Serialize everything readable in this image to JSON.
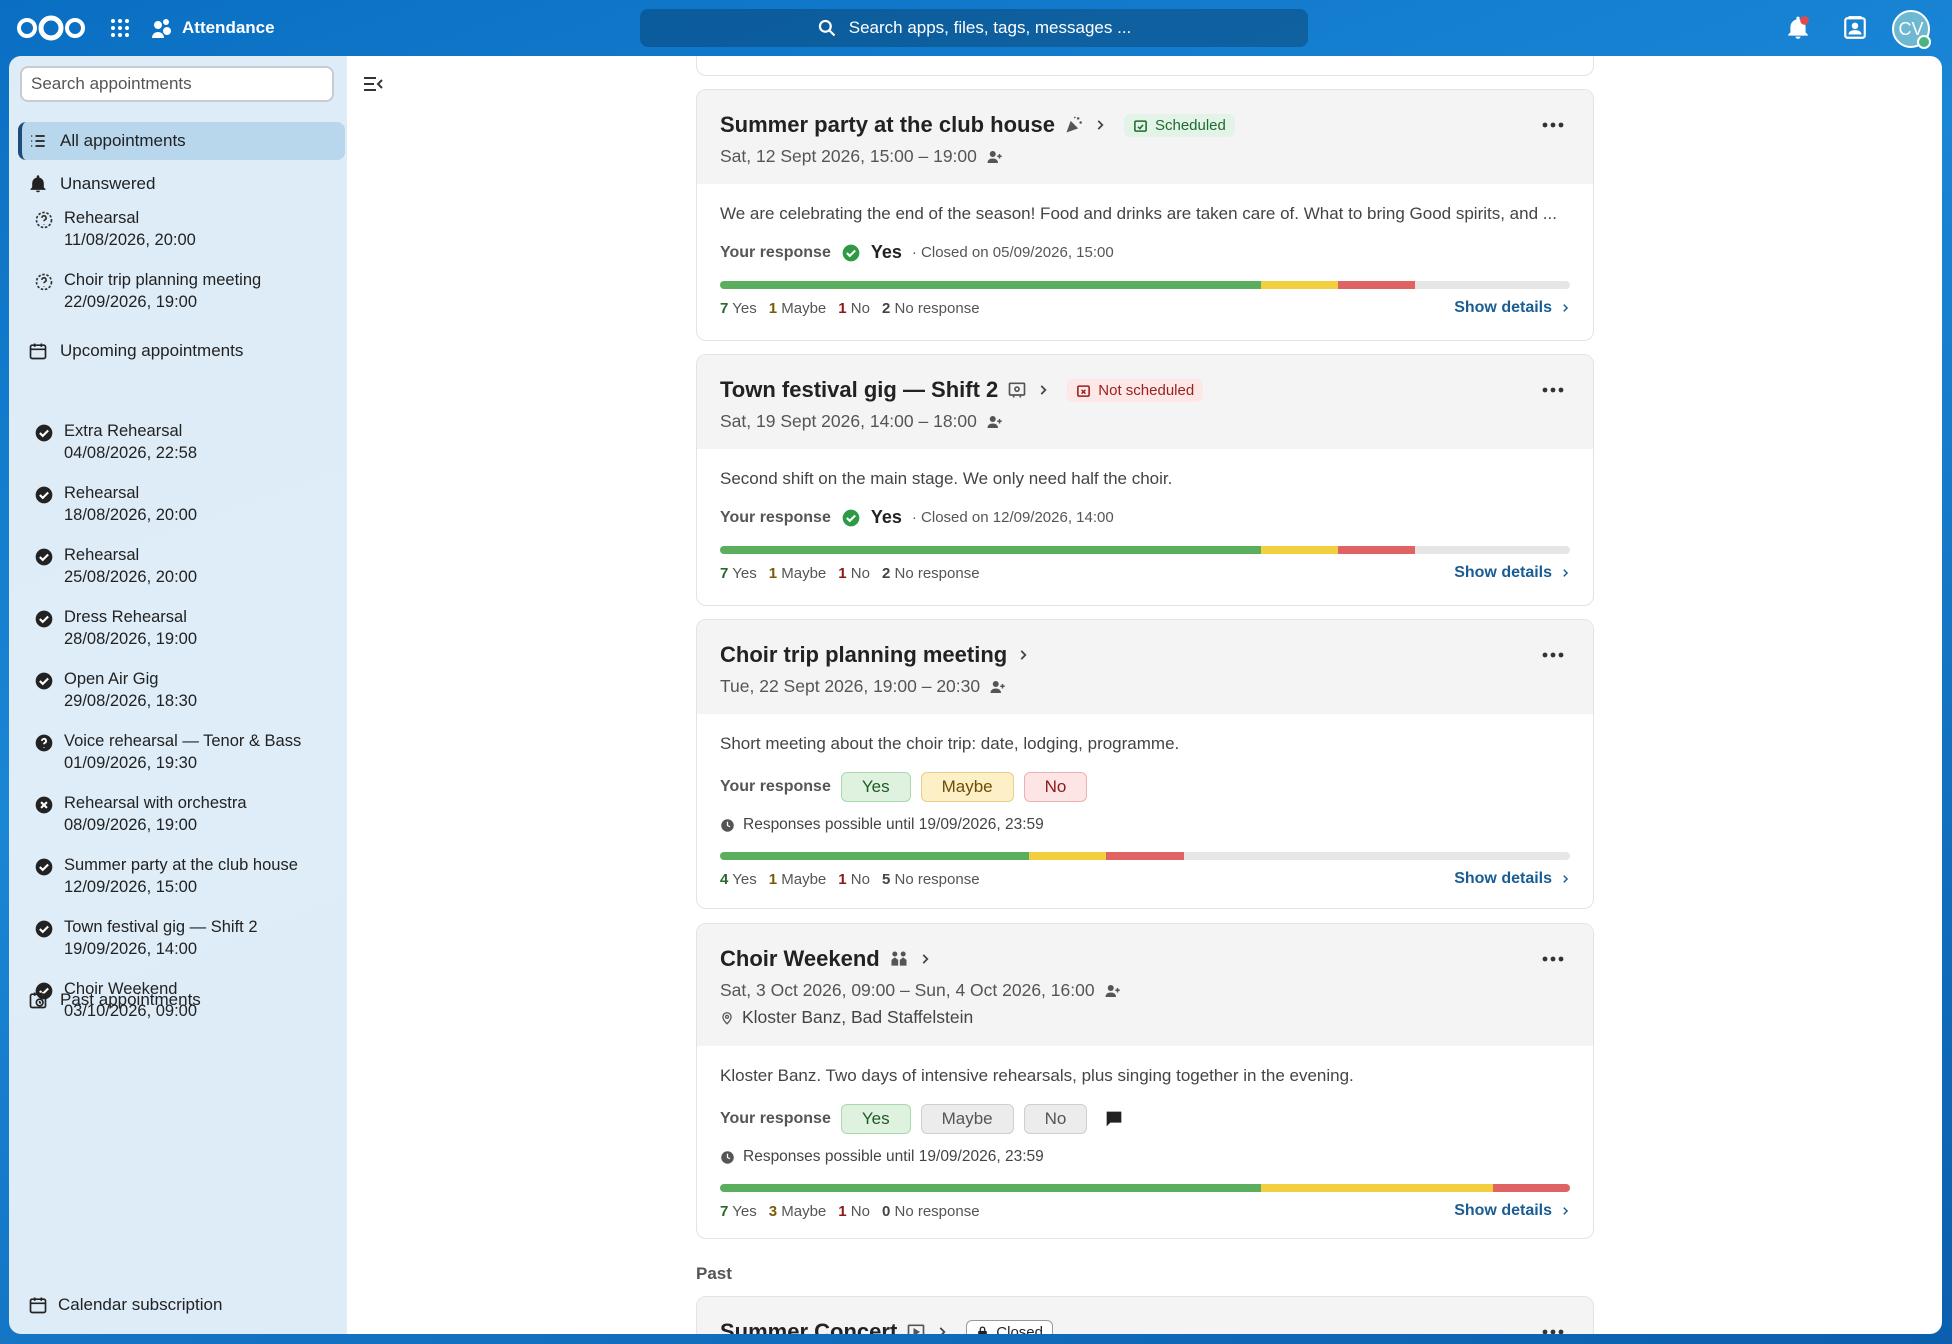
{
  "header": {
    "app_name": "Attendance",
    "search_placeholder": "Search apps, files, tags, messages ...",
    "avatar_initials": "CV"
  },
  "sidebar": {
    "search_placeholder": "Search appointments",
    "all_label": "All appointments",
    "unanswered_label": "Unanswered",
    "unanswered": [
      {
        "title": "Rehearsal",
        "date": "11/08/2026, 20:00"
      },
      {
        "title": "Choir trip planning meeting",
        "date": "22/09/2026, 19:00"
      }
    ],
    "upcoming_label": "Upcoming appointments",
    "upcoming": [
      {
        "title": "Extra Rehearsal",
        "date": "04/08/2026, 22:58",
        "status": "yes"
      },
      {
        "title": "Rehearsal",
        "date": "18/08/2026, 20:00",
        "status": "yes"
      },
      {
        "title": "Rehearsal",
        "date": "25/08/2026, 20:00",
        "status": "yes"
      },
      {
        "title": "Dress Rehearsal",
        "date": "28/08/2026, 19:00",
        "status": "yes"
      },
      {
        "title": "Open Air Gig",
        "date": "29/08/2026, 18:30",
        "status": "yes"
      },
      {
        "title": "Voice rehearsal — Tenor & Bass",
        "date": "01/09/2026, 19:30",
        "status": "maybe"
      },
      {
        "title": "Rehearsal with orchestra",
        "date": "08/09/2026, 19:00",
        "status": "no"
      },
      {
        "title": "Summer party at the club house",
        "date": "12/09/2026, 15:00",
        "status": "yes"
      },
      {
        "title": "Town festival gig — Shift 2",
        "date": "19/09/2026, 14:00",
        "status": "yes"
      },
      {
        "title": "Choir Weekend",
        "date": "03/10/2026, 09:00",
        "status": "yes"
      }
    ],
    "past_label": "Past appointments",
    "footer_label": "Calendar subscription"
  },
  "common": {
    "your_response": "Your response",
    "show_details": "Show details",
    "yes": "Yes",
    "maybe": "Maybe",
    "no": "No",
    "no_response": "No response"
  },
  "cards": [
    {
      "title": "Summer party at the club house",
      "icon": "party-popper-icon",
      "badge": {
        "label": "Scheduled",
        "kind": "ok"
      },
      "time": "Sat, 12 Sept 2026, 15:00 – 19:00",
      "description": "We are celebrating the end of the season! Food and drinks are taken care of. What to bring Good spirits, and ...",
      "response": "Yes",
      "closed_on": "· Closed on 05/09/2026, 15:00",
      "counts": {
        "yes": 7,
        "maybe": 1,
        "no": 1,
        "none": 2
      }
    },
    {
      "title": "Town festival gig — Shift 2",
      "icon": "stage-icon",
      "badge": {
        "label": "Not scheduled",
        "kind": "no"
      },
      "time": "Sat, 19 Sept 2026, 14:00 – 18:00",
      "description": "Second shift on the main stage. We only need half the choir.",
      "response": "Yes",
      "closed_on": "· Closed on 12/09/2026, 14:00",
      "counts": {
        "yes": 7,
        "maybe": 1,
        "no": 1,
        "none": 2
      }
    },
    {
      "title": "Choir trip planning meeting",
      "time": "Tue, 22 Sept 2026, 19:00 – 20:30",
      "description": "Short meeting about the choir trip: date, lodging, programme.",
      "deadline": "Responses possible until 19/09/2026, 23:59",
      "counts": {
        "yes": 4,
        "maybe": 1,
        "no": 1,
        "none": 5
      }
    },
    {
      "title": "Choir Weekend",
      "icon": "people-icon",
      "time": "Sat, 3 Oct 2026, 09:00 – Sun, 4 Oct 2026, 16:00",
      "location": "Kloster Banz, Bad Staffelstein",
      "description": "Kloster Banz. Two days of intensive rehearsals, plus singing together in the evening.",
      "deadline": "Responses possible until 19/09/2026, 23:59",
      "counts": {
        "yes": 7,
        "maybe": 3,
        "no": 1,
        "none": 0
      }
    }
  ],
  "past_heading": "Past",
  "past_card": {
    "title": "Summer Concert",
    "badge": "Closed"
  }
}
